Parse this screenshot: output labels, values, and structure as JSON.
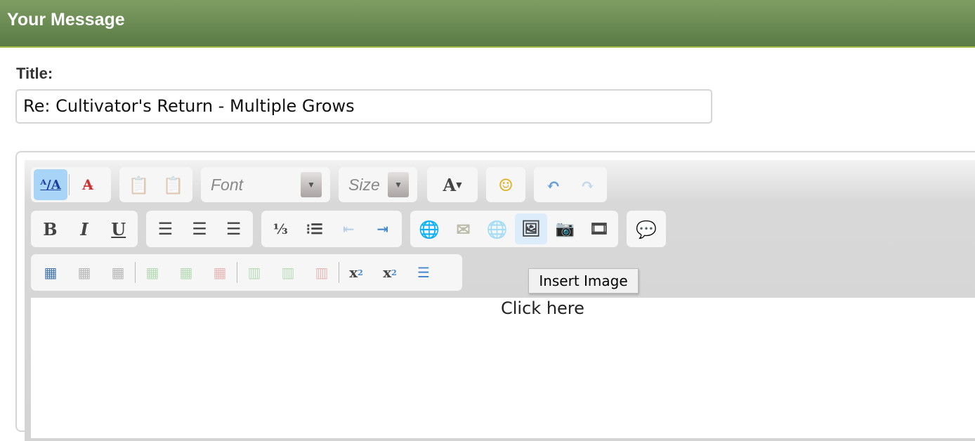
{
  "header": {
    "title": "Your Message"
  },
  "form": {
    "title_label": "Title:",
    "title_value": "Re: Cultivator's Return - Multiple Grows"
  },
  "toolbar": {
    "font_placeholder": "Font",
    "size_placeholder": "Size",
    "tooltip": "Insert Image",
    "icons": [
      "remove-formatting",
      "clear-formatting-x",
      "paste-text",
      "paste-word",
      "font-color",
      "smiley",
      "undo",
      "redo",
      "bold",
      "italic",
      "underline",
      "align-left",
      "align-center",
      "align-right",
      "ordered-list",
      "unordered-list",
      "outdent",
      "indent",
      "insert-link",
      "insert-email",
      "unlink",
      "insert-image",
      "insert-photo",
      "insert-video",
      "quote",
      "table",
      "table-properties",
      "delete-table",
      "insert-column-left",
      "insert-column-right",
      "delete-column",
      "insert-row-below",
      "insert-row-above",
      "delete-row",
      "subscript",
      "superscript",
      "horizontal-rule"
    ]
  },
  "editor": {
    "placeholder": "Click here"
  },
  "colors": {
    "header_top": "#7d9d63",
    "header_bottom": "#5b7b46",
    "active_button": "#a8d4f8"
  }
}
